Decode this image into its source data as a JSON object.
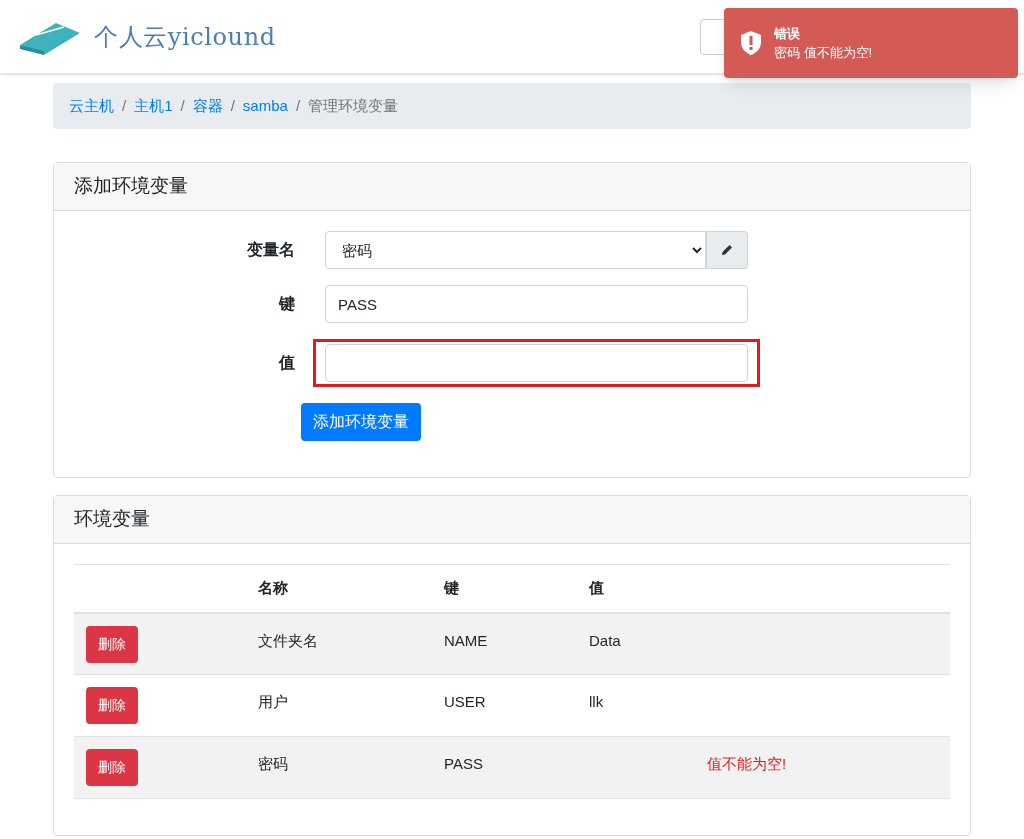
{
  "header": {
    "logo_text": "个人云",
    "logo_suffix": "yiclound"
  },
  "toast": {
    "title": "错误",
    "message": "密码 值不能为空!"
  },
  "breadcrumb_separator": "/",
  "breadcrumb": [
    {
      "label": "云主机",
      "link": true
    },
    {
      "label": "主机1",
      "link": true
    },
    {
      "label": "容器",
      "link": true
    },
    {
      "label": "samba",
      "link": true
    },
    {
      "label": "管理环境变量",
      "link": false
    }
  ],
  "add_form": {
    "title": "添加环境变量",
    "fields": [
      {
        "kind": "select",
        "label": "变量名",
        "value": "密码",
        "error": false
      },
      {
        "kind": "text",
        "label": "键",
        "value": "PASS",
        "error": false
      },
      {
        "kind": "text",
        "label": "值",
        "error": true
      }
    ],
    "submit": "添加环境变量"
  },
  "env_table": {
    "title": "环境变量",
    "columns": [
      "名称",
      "键",
      "值"
    ],
    "rows": [
      {
        "action": "删除",
        "name": "文件夹名",
        "key": "NAME",
        "value": "Data"
      },
      {
        "action": "删除",
        "name": "用户",
        "key": "USER",
        "value": "llk"
      },
      {
        "action": "删除",
        "name": "密码",
        "key": "PASS",
        "error": "值不能为空!"
      }
    ]
  }
}
